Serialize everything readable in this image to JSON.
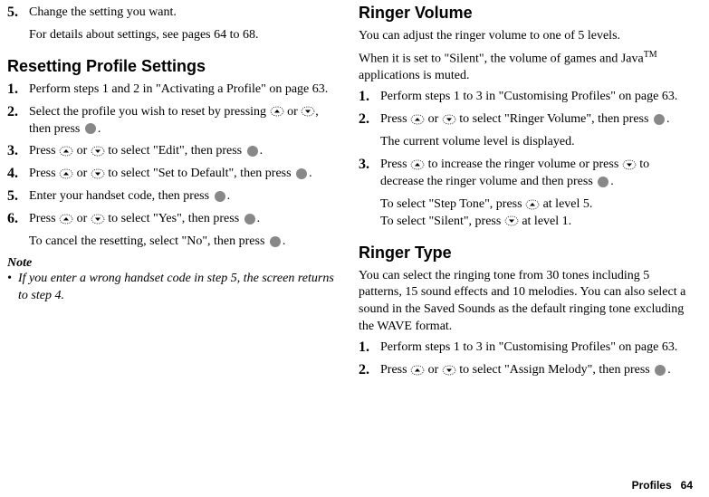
{
  "left": {
    "step5": {
      "num": "5.",
      "text1": "Change the setting you want.",
      "text2": "For details about settings, see pages 64 to 68."
    },
    "h_reset": "Resetting Profile Settings",
    "r1": {
      "num": "1.",
      "text": "Perform steps 1 and 2 in \"Activating a Profile\" on page 63."
    },
    "r2": {
      "num": "2.",
      "a": "Select the profile you wish to reset by pressing ",
      "b": " or ",
      "c": ", then press ",
      "d": "."
    },
    "r3": {
      "num": "3.",
      "a": "Press ",
      "b": " or ",
      "c": " to select \"Edit\", then press ",
      "d": "."
    },
    "r4": {
      "num": "4.",
      "a": "Press ",
      "b": " or ",
      "c": " to select \"Set to Default\", then press ",
      "d": "."
    },
    "r5": {
      "num": "5.",
      "a": "Enter your handset code, then press ",
      "b": "."
    },
    "r6": {
      "num": "6.",
      "a": "Press ",
      "b": " or ",
      "c": " to select \"Yes\", then press ",
      "d": ".",
      "cancel_a": "To cancel the resetting, select \"No\", then press ",
      "cancel_b": "."
    },
    "note_label": "Note",
    "note_text": "If you enter a wrong handset code in step 5, the screen returns to step 4."
  },
  "right": {
    "h_ringer_vol": "Ringer Volume",
    "vol_intro1": "You can adjust the ringer volume to one of 5 levels.",
    "vol_intro2a": "When it is set to \"Silent\", the volume of games and Java",
    "vol_intro2_tm": "TM",
    "vol_intro2b": " applications is muted.",
    "v1": {
      "num": "1.",
      "text": "Perform steps 1 to 3 in \"Customising Profiles\" on page 63."
    },
    "v2": {
      "num": "2.",
      "a": "Press ",
      "b": " or ",
      "c": " to select \"Ringer Volume\", then press ",
      "d": ".",
      "e": "The current volume level is displayed."
    },
    "v3": {
      "num": "3.",
      "a": "Press ",
      "b": " to increase the ringer volume or press ",
      "c": " to decrease the ringer volume and then press ",
      "d": ".",
      "step_a": "To select \"Step Tone\", press ",
      "step_b": " at level 5.",
      "sil_a": "To select \"Silent\", press ",
      "sil_b": " at level 1."
    },
    "h_ringer_type": "Ringer Type",
    "type_intro": "You can select the ringing tone from 30 tones including 5 patterns, 15 sound effects and 10 melodies. You can also select a sound in the Saved Sounds as the default ringing tone excluding the WAVE format.",
    "t1": {
      "num": "1.",
      "text": "Perform steps 1 to 3 in \"Customising Profiles\" on page 63."
    },
    "t2": {
      "num": "2.",
      "a": "Press ",
      "b": " or ",
      "c": " to select \"Assign Melody\", then press ",
      "d": "."
    }
  },
  "footer": {
    "label": "Profiles",
    "page": "64"
  }
}
